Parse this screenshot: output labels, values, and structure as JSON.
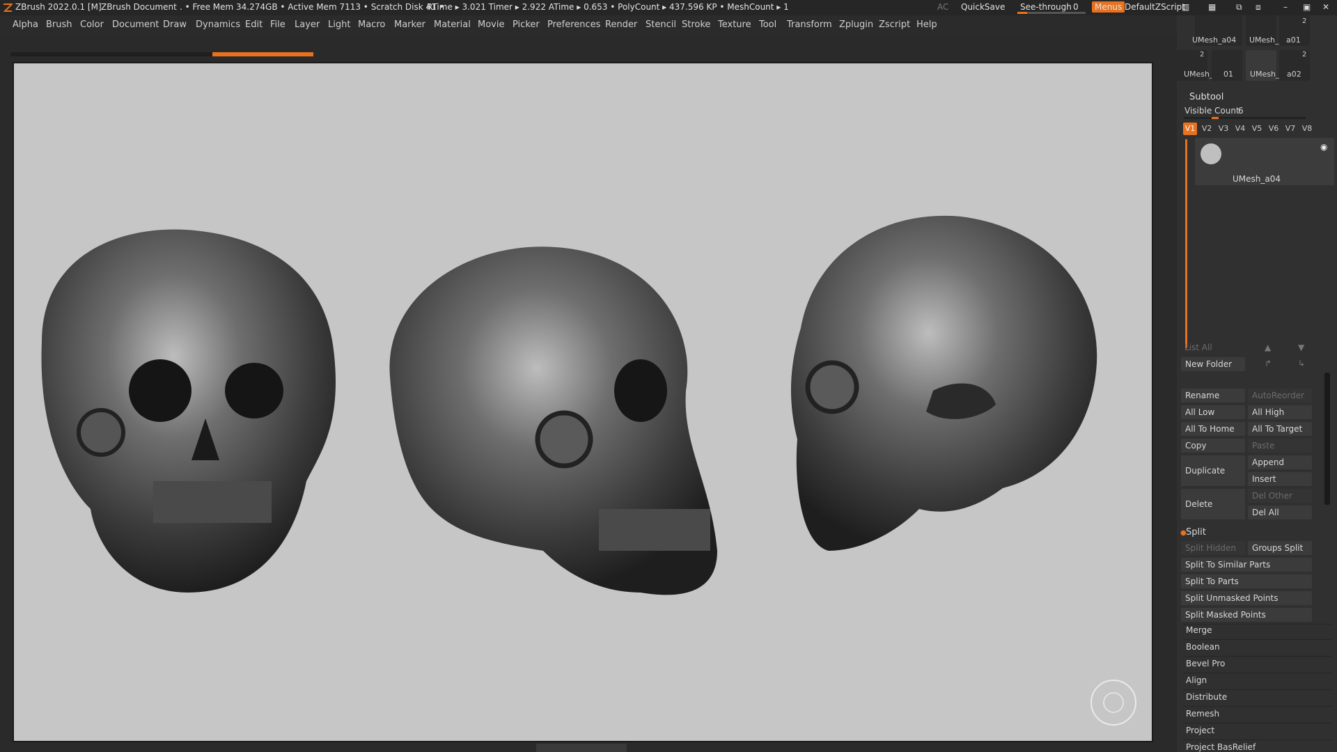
{
  "titlebar": {
    "app": "ZBrush 2022.0.1 [M]",
    "document": "ZBrush Document",
    "stats": ". • Free Mem 34.274GB • Active Mem 7113 • Scratch Disk 41 •",
    "timing": "RTime ▸ 3.021 Timer ▸ 2.922 ATime ▸ 0.653 • PolyCount ▸ 437.596 KP • MeshCount ▸ 1",
    "ac": "AC",
    "quicksave": "QuickSave",
    "see_through_label": "See-through",
    "see_through_value": "0",
    "menus": "Menus",
    "default_zscript": "DefaultZScript",
    "accent": "#e8721e"
  },
  "menubar": {
    "items": [
      "Alpha",
      "Brush",
      "Color",
      "Document",
      "Draw",
      "Dynamics",
      "Edit",
      "File",
      "Layer",
      "Light",
      "Macro",
      "Marker",
      "Material",
      "Movie",
      "Picker",
      "Preferences",
      "Render",
      "Stencil",
      "Stroke",
      "Texture",
      "Tool",
      "Transform",
      "Zplugin",
      "Zscript",
      "Help"
    ]
  },
  "tool_thumbs": {
    "row1": [
      "UMesh_a04",
      "UMesh_",
      "a01"
    ],
    "row2": [
      "UMesh_",
      "01",
      "UMesh_",
      "a02"
    ],
    "badges": [
      "2",
      "2",
      "2"
    ]
  },
  "subtool": {
    "title": "Subtool",
    "visible_count_label": "Visible Count",
    "visible_count": "6",
    "views": [
      "V1",
      "V2",
      "V3",
      "V4",
      "V5",
      "V6",
      "V7",
      "V8"
    ],
    "active_item": "UMesh_a04",
    "list_all": "List All",
    "new_folder": "New Folder",
    "rename": "Rename",
    "auto_reorder": "AutoReorder",
    "all_low": "All Low",
    "all_high": "All High",
    "all_to_home": "All To Home",
    "all_to_target": "All To Target",
    "copy": "Copy",
    "paste": "Paste",
    "duplicate": "Duplicate",
    "append": "Append",
    "insert": "Insert",
    "delete": "Delete",
    "del_other": "Del Other",
    "del_all": "Del All",
    "split": "Split",
    "split_hidden": "Split Hidden",
    "groups_split": "Groups Split",
    "split_similar": "Split To Similar Parts",
    "split_parts": "Split To Parts",
    "split_unmasked": "Split Unmasked Points",
    "split_masked": "Split Masked Points",
    "sections": [
      "Merge",
      "Boolean",
      "Bevel Pro",
      "Align",
      "Distribute",
      "Remesh",
      "Project",
      "Project BasRelief"
    ]
  }
}
